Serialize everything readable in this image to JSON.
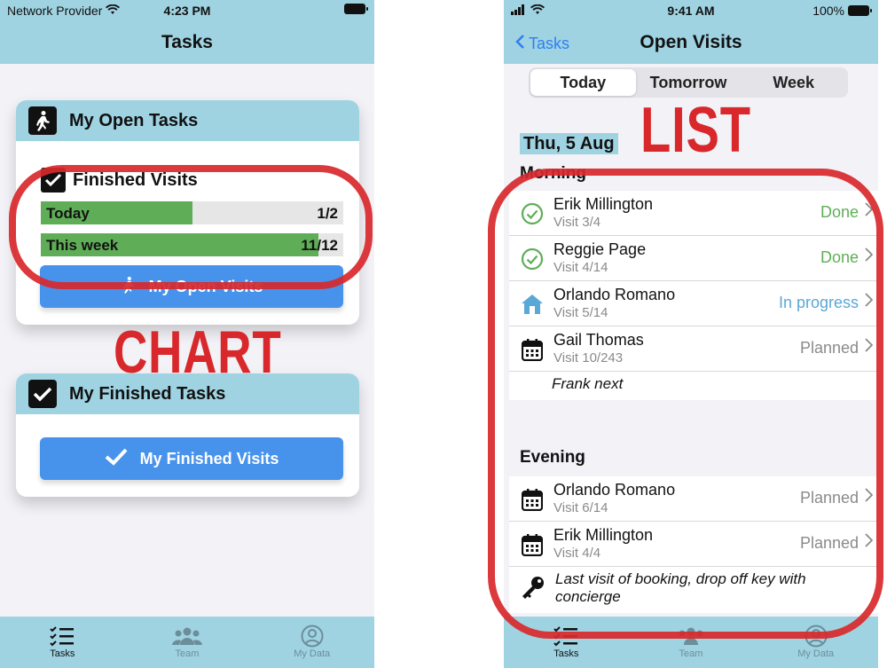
{
  "left": {
    "status": {
      "carrier": "Network Provider",
      "time": "4:23 PM"
    },
    "nav_title": "Tasks",
    "open_card": {
      "title": "My Open Tasks",
      "finished_label": "Finished Visits",
      "bars": [
        {
          "label": "Today",
          "count": "1/2",
          "fraction": 0.5
        },
        {
          "label": "This week",
          "count": "11/12",
          "fraction": 0.917
        }
      ],
      "button_label": "My Open Visits"
    },
    "finished_card": {
      "title": "My Finished Tasks",
      "button_label": "My Finished Visits"
    },
    "tabs": [
      "Tasks",
      "Team",
      "My Data"
    ]
  },
  "right": {
    "status": {
      "time": "9:41 AM",
      "battery": "100%"
    },
    "back_label": "Tasks",
    "nav_title": "Open Visits",
    "segments": [
      "Today",
      "Tomorrow",
      "Week"
    ],
    "date": "Thu, 5 Aug",
    "morning_label": "Morning",
    "evening_label": "Evening",
    "morning": [
      {
        "name": "Erik Millington",
        "sub": "Visit 3/4",
        "status": "Done",
        "color": "#5fae57",
        "icon": "check-circle-icon"
      },
      {
        "name": "Reggie Page",
        "sub": "Visit 4/14",
        "status": "Done",
        "color": "#5fae57",
        "icon": "check-circle-icon"
      },
      {
        "name": "Orlando Romano",
        "sub": "Visit 5/14",
        "status": "In progress",
        "color": "#5aa8d6",
        "icon": "house-icon"
      },
      {
        "name": "Gail Thomas",
        "sub": "Visit 10/243",
        "status": "Planned",
        "color": "#8a8a8e",
        "icon": "calendar-icon"
      }
    ],
    "morning_note": "Frank next",
    "evening": [
      {
        "name": "Orlando Romano",
        "sub": "Visit 6/14",
        "status": "Planned",
        "color": "#8a8a8e",
        "icon": "calendar-icon"
      },
      {
        "name": "Erik Millington",
        "sub": "Visit 4/4",
        "status": "Planned",
        "color": "#8a8a8e",
        "icon": "calendar-icon"
      }
    ],
    "evening_note": "Last visit of booking, drop off key with concierge",
    "tabs": [
      "Tasks",
      "Team",
      "My Data"
    ]
  },
  "annotations": {
    "chart": "CHART",
    "list": "LIST",
    "color": "#d8282b"
  }
}
